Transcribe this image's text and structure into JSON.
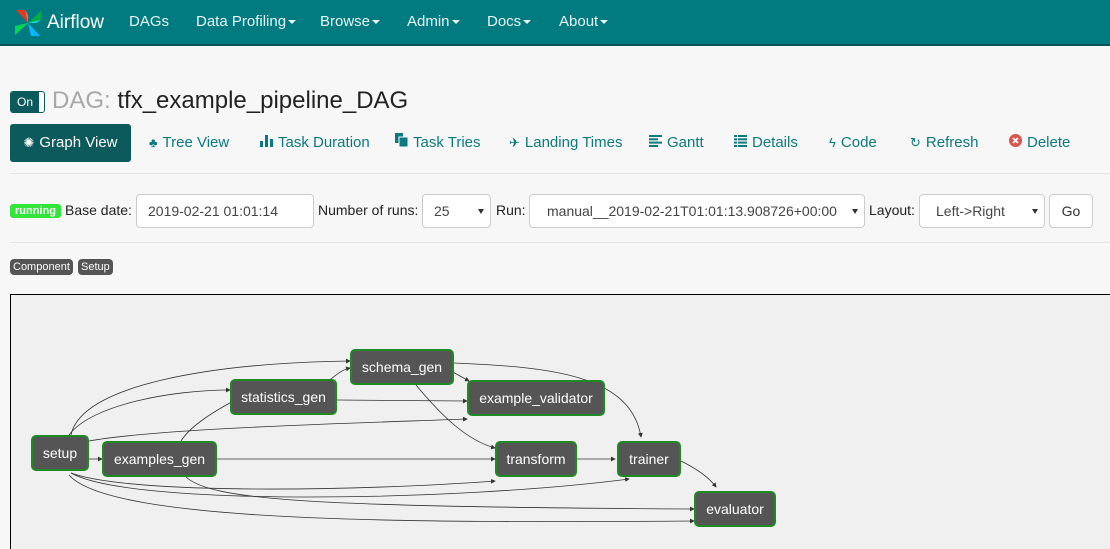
{
  "nav": {
    "brand": "Airflow",
    "items": [
      {
        "label": "DAGs",
        "dropdown": false
      },
      {
        "label": "Data Profiling",
        "dropdown": true
      },
      {
        "label": "Browse",
        "dropdown": true
      },
      {
        "label": "Admin",
        "dropdown": true
      },
      {
        "label": "Docs",
        "dropdown": true
      },
      {
        "label": "About",
        "dropdown": true
      }
    ]
  },
  "header": {
    "toggle": "On",
    "prefix": "DAG:",
    "dag_id": "tfx_example_pipeline_DAG"
  },
  "tabs": [
    {
      "label": "Graph View",
      "icon": "certificate-icon",
      "active": true
    },
    {
      "label": "Tree View",
      "icon": "tree-icon"
    },
    {
      "label": "Task Duration",
      "icon": "bar-chart-icon"
    },
    {
      "label": "Task Tries",
      "icon": "files-icon"
    },
    {
      "label": "Landing Times",
      "icon": "plane-icon"
    },
    {
      "label": "Gantt",
      "icon": "align-left-icon"
    },
    {
      "label": "Details",
      "icon": "list-icon"
    },
    {
      "label": "Code",
      "icon": "flash-icon"
    },
    {
      "label": "Refresh",
      "icon": "refresh-icon"
    },
    {
      "label": "Delete",
      "icon": "remove-circle-icon"
    }
  ],
  "controls": {
    "state_badge": "running",
    "base_date_label": "Base date:",
    "base_date_value": "2019-02-21 01:01:14",
    "num_runs_label": "Number of runs:",
    "num_runs_value": "25",
    "run_label": "Run:",
    "run_value": "manual__2019-02-21T01:01:13.908726+00:00",
    "layout_label": "Layout:",
    "layout_value": "Left->Right",
    "go_label": "Go"
  },
  "legend": [
    "Component",
    "Setup"
  ],
  "graph": {
    "nodes": [
      "setup",
      "examples_gen",
      "statistics_gen",
      "schema_gen",
      "example_validator",
      "transform",
      "trainer",
      "evaluator"
    ],
    "node_border_color": "#1e8a24",
    "node_fill_color": "#555555"
  }
}
